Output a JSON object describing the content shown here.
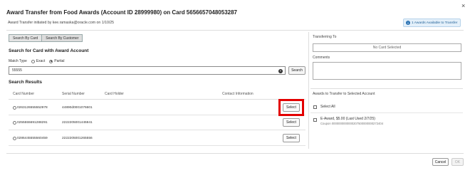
{
  "dialog": {
    "title": "Award Transfer from Food Awards (Account ID 28999980) on Card 5656657048053287",
    "subtitle": "Award Transfer initiated by kee.ramaska@oracle.com on 1/10/25",
    "close_glyph": "×",
    "info_badge": "1 Awards Available to Transfer"
  },
  "tabs": [
    {
      "label": "Search By Card",
      "active": true
    },
    {
      "label": "Search By Customer",
      "active": false
    }
  ],
  "search": {
    "heading": "Search for Card with Award Account",
    "match_type_label": "Match Type",
    "options": [
      {
        "label": "Exact",
        "checked": false
      },
      {
        "label": "Partial",
        "checked": true
      }
    ],
    "value": "55555",
    "clear_glyph": "×",
    "button_label": "Search"
  },
  "results": {
    "heading": "Search Results",
    "columns": [
      "Card Number",
      "Serial Number",
      "Card Holder",
      "Contact Information"
    ],
    "rows": [
      {
        "card": "0263126555552978",
        "serial": "44890d0001076601",
        "holder": "",
        "contact": "",
        "action": "Select"
      },
      {
        "card": "0255555691288291",
        "serial": "2222205001445941",
        "holder": "",
        "contact": "",
        "action": "Select"
      },
      {
        "card": "0286445555560459",
        "serial": "2222205001265556",
        "holder": "",
        "contact": "",
        "action": "Select"
      }
    ]
  },
  "right": {
    "transferring_to_label": "Transferring To",
    "no_card_selected": "No Card Selected",
    "comments_label": "Comments",
    "awards_heading": "Awards to Transfer to Selected Account",
    "select_all_label": "Select All",
    "award_item": "E-Award, $5.00 (Last Used 2/7/25)",
    "award_coupon": "Coupon 0000000000000207500000000272404"
  },
  "footer": {
    "cancel_label": "Cancel",
    "ok_label": "OK"
  },
  "colors": {
    "highlight": "#e30000",
    "info_accent": "#2770b2"
  }
}
